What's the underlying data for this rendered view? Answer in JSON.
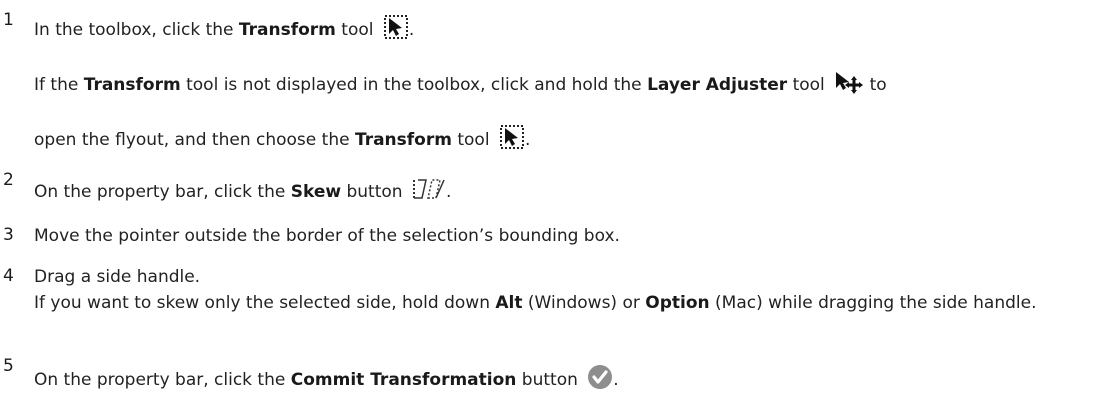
{
  "steps": [
    {
      "number": "1",
      "lines": [
        {
          "t1": "In the toolbox, click the ",
          "b1": "Transform",
          "t2": " tool",
          "end": "."
        },
        {
          "t1": "If the ",
          "b1": "Transform",
          "t2": " tool is not displayed in the toolbox, click and hold the ",
          "b2": "Layer Adjuster",
          "t3": " tool",
          "t4": " to"
        },
        {
          "t1": "open the flyout, and then choose the ",
          "b1": "Transform",
          "t2": " tool",
          "end": "."
        }
      ]
    },
    {
      "number": "2",
      "lines": [
        {
          "t1": "On the property bar, click the ",
          "b1": "Skew",
          "t2": " button",
          "end": "."
        }
      ]
    },
    {
      "number": "3",
      "lines": [
        {
          "t1": "Move the pointer outside the border of the selection’s bounding box."
        }
      ]
    },
    {
      "number": "4",
      "lines": [
        {
          "t1": "Drag a side handle."
        },
        {
          "t1": "If you want to skew only the selected side, hold down ",
          "b1": "Alt",
          "t2": " (Windows) or ",
          "b2": "Option",
          "t3": " (Mac) while dragging the side handle."
        }
      ]
    },
    {
      "number": "5",
      "lines": [
        {
          "t1": "On the property bar, click the ",
          "b1": "Commit Transformation",
          "t2": " button",
          "end": "."
        }
      ]
    }
  ],
  "icons": {
    "transform": "transform-tool-icon",
    "layer_adjuster": "layer-adjuster-tool-icon",
    "skew": "skew-button-icon",
    "commit": "commit-transformation-icon"
  }
}
